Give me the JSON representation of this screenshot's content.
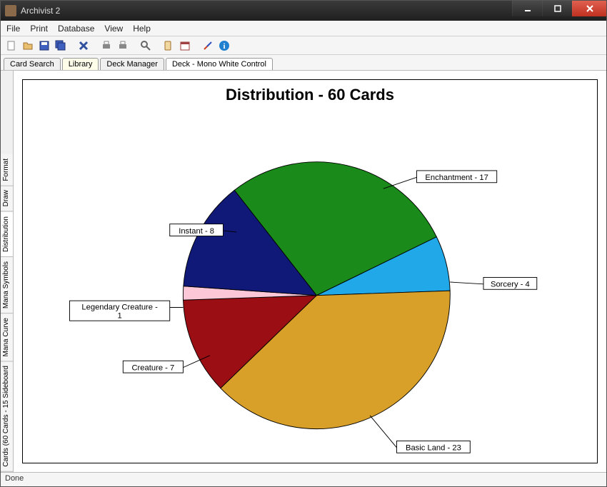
{
  "window": {
    "title": "Archivist 2"
  },
  "menu": {
    "file": "File",
    "print": "Print",
    "database": "Database",
    "view": "View",
    "help": "Help"
  },
  "tabs": {
    "card_search": "Card Search",
    "library": "Library",
    "deck_manager": "Deck Manager",
    "deck": "Deck - Mono White Control"
  },
  "vtabs": {
    "cards": "Cards (60 Cards - 15 Sideboard",
    "mana_curve": "Mana Curve",
    "mana_symbols": "Mana Symbols",
    "distribution": "Distribution",
    "draw": "Draw",
    "format": "Format"
  },
  "status": "Done",
  "chart_data": {
    "type": "pie",
    "title": "Distribution - 60 Cards",
    "series": [
      {
        "name": "Enchantment",
        "value": 17,
        "color": "#1a8a1a",
        "label": "Enchantment - 17"
      },
      {
        "name": "Sorcery",
        "value": 4,
        "color": "#20a8e8",
        "label": "Sorcery - 4"
      },
      {
        "name": "Basic Land",
        "value": 23,
        "color": "#d8a028",
        "label": "Basic Land - 23"
      },
      {
        "name": "Creature",
        "value": 7,
        "color": "#9a0e14",
        "label": "Creature - 7"
      },
      {
        "name": "Legendary Creature",
        "value": 1,
        "color": "#fcc8d8",
        "label": "Legendary Creature - 1"
      },
      {
        "name": "Instant",
        "value": 8,
        "color": "#101878",
        "label": "Instant - 8"
      }
    ]
  }
}
